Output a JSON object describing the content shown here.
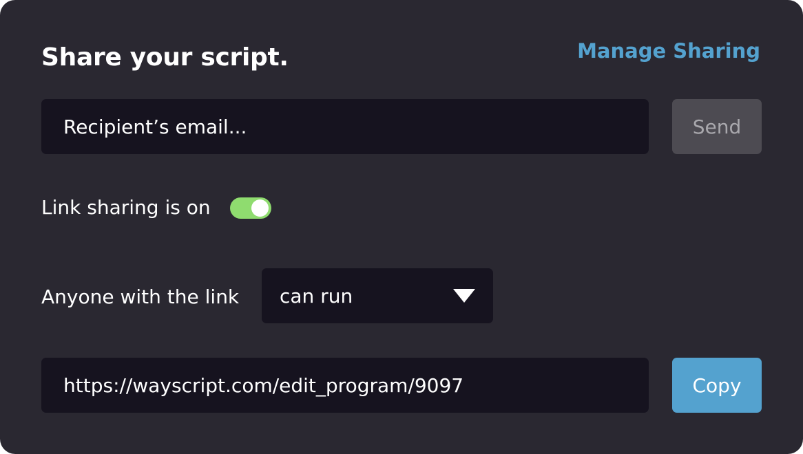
{
  "dialog": {
    "title": "Share your script.",
    "manage_link": "Manage Sharing"
  },
  "email": {
    "placeholder": "Recipient’s email...",
    "value": ""
  },
  "send_button": "Send",
  "link_sharing": {
    "label": "Link sharing is on",
    "enabled": true
  },
  "permission": {
    "label": "Anyone with the link",
    "selected": "can run"
  },
  "link": {
    "url": "https://wayscript.com/edit_program/9097"
  },
  "copy_button": "Copy",
  "colors": {
    "background": "#2a2831",
    "field": "#16131f",
    "accent": "#54a2cf",
    "toggle_on": "#8fdc6f",
    "send_disabled": "#4d4b52"
  },
  "icons": {
    "dropdown": "caret-down-icon",
    "toggle": "toggle-switch"
  }
}
